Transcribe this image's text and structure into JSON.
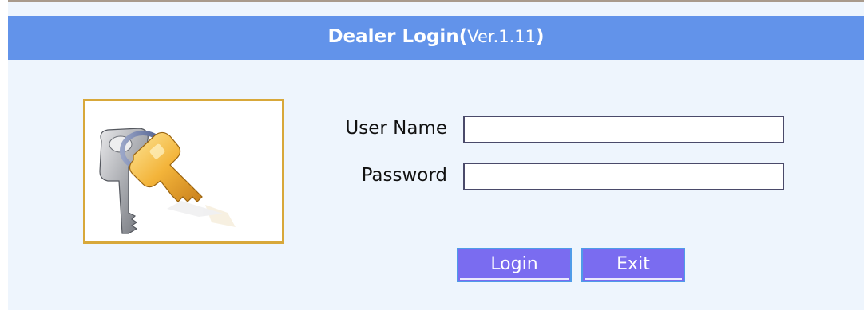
{
  "header": {
    "title": "Dealer Login",
    "paren_open": "(",
    "version": "Ver.1.11",
    "paren_close": ")"
  },
  "form": {
    "username_label": "User Name",
    "username_value": "",
    "password_label": "Password",
    "password_value": ""
  },
  "buttons": {
    "login": "Login",
    "exit": "Exit"
  },
  "colors": {
    "header_bg": "#6293ea",
    "page_bg": "#eef5fd",
    "button_bg": "#7a6cf0",
    "button_border": "#4f9be8",
    "image_border": "#d8a83a"
  },
  "icons": {
    "login_image": "keys-icon"
  }
}
